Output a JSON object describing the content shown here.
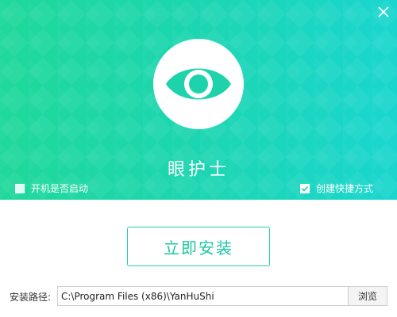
{
  "window": {
    "close_icon": "close-icon"
  },
  "hero": {
    "app_name": "眼护士",
    "logo_icon": "eye-icon",
    "colors": {
      "gradient_start": "#1fd89a",
      "gradient_end": "#1ad6cf",
      "eye": "#1ed3ac"
    }
  },
  "options": {
    "autostart": {
      "label": "开机是否启动",
      "checked": false
    },
    "shortcut": {
      "label": "创建快捷方式",
      "checked": true
    }
  },
  "install": {
    "button_label": "立即安装",
    "accent": "#1cc99f"
  },
  "path": {
    "label": "安装路径:",
    "value": "C:\\Program Files (x86)\\YanHuShi",
    "browse_label": "浏览"
  }
}
